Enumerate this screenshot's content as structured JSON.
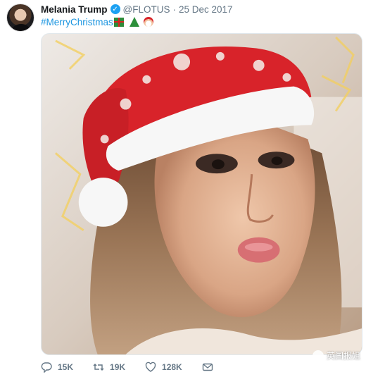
{
  "tweet": {
    "author_name": "Melania Trump",
    "handle": "@FLOTUS",
    "separator": "·",
    "date": "25 Dec 2017",
    "hashtag": "#MerryChristmas",
    "emojis": [
      "wrapped-gift",
      "christmas-tree",
      "santa-claus"
    ]
  },
  "actions": {
    "replies": "15K",
    "retweets": "19K",
    "likes": "128K"
  },
  "watermark": {
    "text": "英国报姐"
  },
  "colors": {
    "link": "#1b95e0",
    "verified": "#1da1f2",
    "meta": "#657786",
    "text": "#14171a"
  }
}
